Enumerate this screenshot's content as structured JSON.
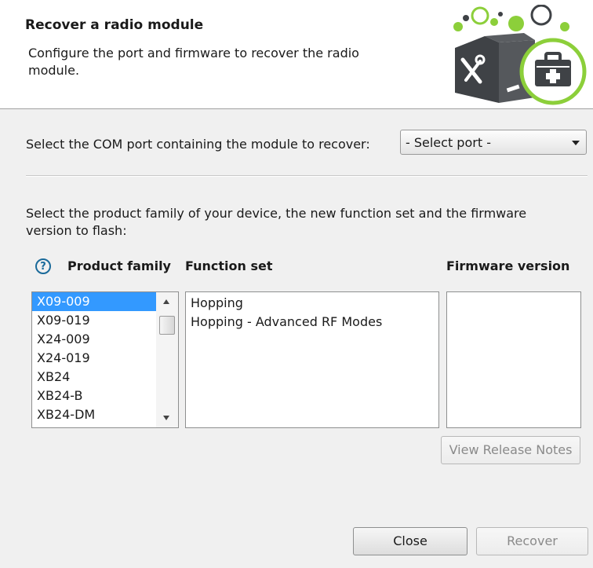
{
  "header": {
    "title": "Recover a radio module",
    "description": "Configure the port and firmware to recover the radio module."
  },
  "port": {
    "label": "Select the COM port containing the module to recover:",
    "selected": "- Select port -"
  },
  "family_instruction": "Select the product family of your device, the new function set and the firmware version to flash:",
  "columns": {
    "product_family": "Product family",
    "function_set": "Function set",
    "firmware_version": "Firmware version"
  },
  "help_glyph": "?",
  "product_families": [
    {
      "label": "X09-009",
      "selected": true
    },
    {
      "label": "X09-019",
      "selected": false
    },
    {
      "label": "X24-009",
      "selected": false
    },
    {
      "label": "X24-019",
      "selected": false
    },
    {
      "label": "XB24",
      "selected": false
    },
    {
      "label": "XB24-B",
      "selected": false
    },
    {
      "label": "XB24-DM",
      "selected": false
    }
  ],
  "function_sets": [
    "Hopping",
    "Hopping - Advanced RF Modes"
  ],
  "firmware_versions": [],
  "buttons": {
    "view_release_notes": "View Release Notes",
    "close": "Close",
    "recover": "Recover"
  },
  "icons": [
    "tools-icon",
    "toolbox-icon",
    "help-icon",
    "chevron-down-icon"
  ],
  "colors": {
    "selection": "#3399ff",
    "logo_green": "#8ccf3a",
    "logo_dark": "#3f4246",
    "help_icon": "#1a6a9a"
  }
}
